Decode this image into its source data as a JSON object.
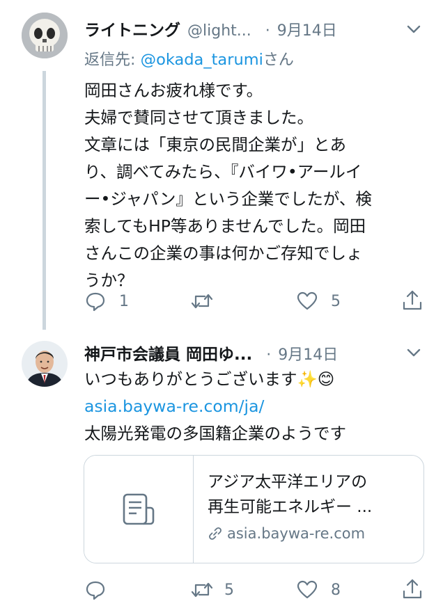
{
  "tweet1": {
    "display_name": "ライトニング",
    "handle": "@light...",
    "separator": "·",
    "date": "9月14日",
    "reply_prefix": "返信先:",
    "reply_handle": "@okada_tarumi",
    "reply_suffix": "さん",
    "text_lines": [
      "岡田さんお疲れ様です。",
      "夫婦で賛同させて頂きました。",
      "文章には「東京の民間企業が」とあ",
      "り、調べてみたら、『バイワ•アールイ",
      "ー•ジャパン』という企業でしたが、検",
      "索してもHP等ありませんでした。岡田",
      "さんこの企業の事は何かご存知でしょ",
      "うか？"
    ],
    "reply_count": "1",
    "like_count": "5"
  },
  "tweet2": {
    "display_name": "神戸市会議員 岡田ゆ...",
    "separator": "·",
    "date": "9月14日",
    "line1": "いつもありがとうございます✨😊",
    "link": "asia.baywa-re.com/ja/",
    "line3": "太陽光発電の多国籍企業のようです",
    "card": {
      "title_line1": "アジア太平洋エリアの",
      "title_line2": "再生可能エネルギー ...",
      "url": "asia.baywa-re.com"
    },
    "retweet_count": "5",
    "like_count": "8"
  },
  "icons": {
    "reply": "reply-icon",
    "retweet": "retweet-icon",
    "like": "heart-icon",
    "share": "share-icon",
    "caret": "chevron-down-icon",
    "document": "document-icon",
    "link": "link-icon"
  },
  "colors": {
    "link": "#1b95e0",
    "muted": "#657786",
    "border": "#ccd6dd"
  }
}
